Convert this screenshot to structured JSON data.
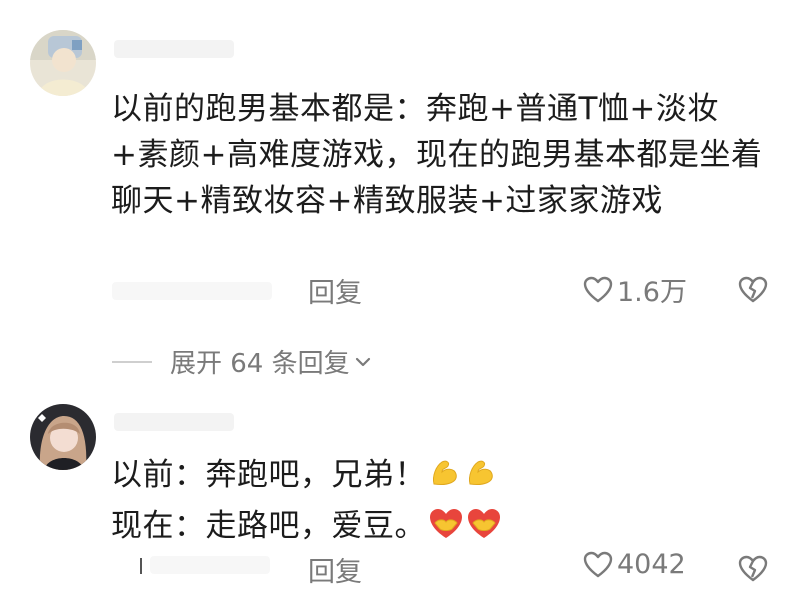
{
  "comments": [
    {
      "text": "以前的跑男基本都是：奔跑+普通T恤+淡妆+素颜+高难度游戏，现在的跑男基本都是坐着聊天+精致妆容+精致服装+过家家游戏",
      "reply_label": "回复",
      "like_count": "1.6万",
      "icons": [
        "heart-outline-icon",
        "broken-heart-icon"
      ]
    },
    {
      "line1": "以前：奔跑吧，兄弟！",
      "line2": "现在：走路吧，爱豆。",
      "reply_label": "回复",
      "like_count": "4042",
      "emojis_line1": [
        "flexed-biceps-icon",
        "flexed-biceps-icon"
      ],
      "emojis_line2": [
        "handshake-heart-icon",
        "handshake-heart-icon"
      ]
    }
  ],
  "expand": {
    "label": "展开 64 条回复",
    "icon": "chevron-down-icon"
  },
  "colors": {
    "text": "#1c1c1c",
    "muted": "#7a7a7a",
    "emoji_yellow": "#f7c531",
    "emoji_red": "#e8453c"
  }
}
